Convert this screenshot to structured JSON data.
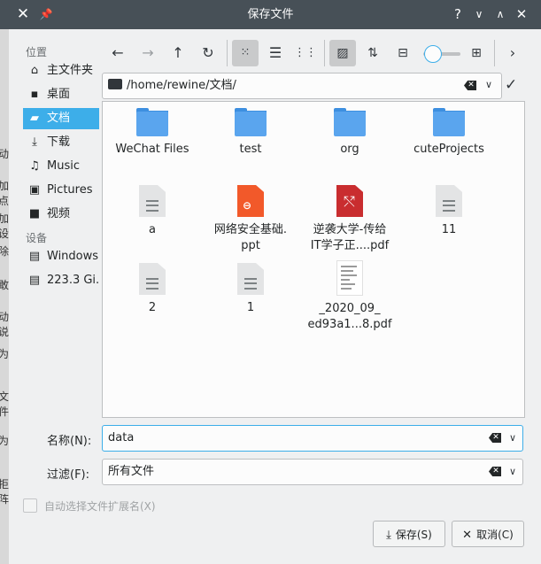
{
  "window": {
    "title": "保存文件"
  },
  "background_fragments": [
    "动",
    "加点",
    "加设",
    "除",
    "敢",
    "动说",
    "为",
    "文件",
    "为",
    "拒阵"
  ],
  "sidebar": {
    "places_heading": "位置",
    "places": [
      {
        "label": "主文件夹",
        "icon": "home-icon"
      },
      {
        "label": "桌面",
        "icon": "desktop-icon"
      },
      {
        "label": "文档",
        "icon": "documents-icon",
        "selected": true
      },
      {
        "label": "下载",
        "icon": "download-icon"
      },
      {
        "label": "Music",
        "icon": "music-icon"
      },
      {
        "label": "Pictures",
        "icon": "pictures-icon"
      },
      {
        "label": "视频",
        "icon": "video-icon"
      }
    ],
    "devices_heading": "设备",
    "devices": [
      {
        "label": "Windows",
        "icon": "drive-icon"
      },
      {
        "label": "223.3 Gi...",
        "icon": "drive-icon"
      }
    ]
  },
  "toolbar": {
    "buttons": [
      "back-icon",
      "forward-icon",
      "up-icon",
      "reload-icon",
      "icon-view-icon",
      "list-view-icon",
      "compact-view-icon",
      "preview-icon",
      "sort-icon",
      "zoom-out-icon",
      "zoom-in-icon",
      "more-icon"
    ]
  },
  "path": {
    "value": "/home/rewine/文档/"
  },
  "files": [
    {
      "name": "WeChat Files",
      "type": "folder"
    },
    {
      "name": "test",
      "type": "folder"
    },
    {
      "name": "org",
      "type": "folder"
    },
    {
      "name": "cuteProjects",
      "type": "folder"
    },
    {
      "name": "a",
      "type": "text"
    },
    {
      "name": "网络安全基础.\nppt",
      "type": "ppt"
    },
    {
      "name": "逆袭大学-传给\nIT学子正....pdf",
      "type": "pdf"
    },
    {
      "name": "11",
      "type": "text"
    },
    {
      "name": "2",
      "type": "text"
    },
    {
      "name": "1",
      "type": "text"
    },
    {
      "name": "_2020_09_\ned93a1...8.pdf",
      "type": "pdf-thumb"
    }
  ],
  "form": {
    "name_label": "名称(N):",
    "name_value": "data",
    "filter_label": "过滤(F):",
    "filter_value": "所有文件",
    "auto_ext_label": "自动选择文件扩展名(X)"
  },
  "buttons": {
    "save": "保存(S)",
    "cancel": "取消(C)"
  }
}
